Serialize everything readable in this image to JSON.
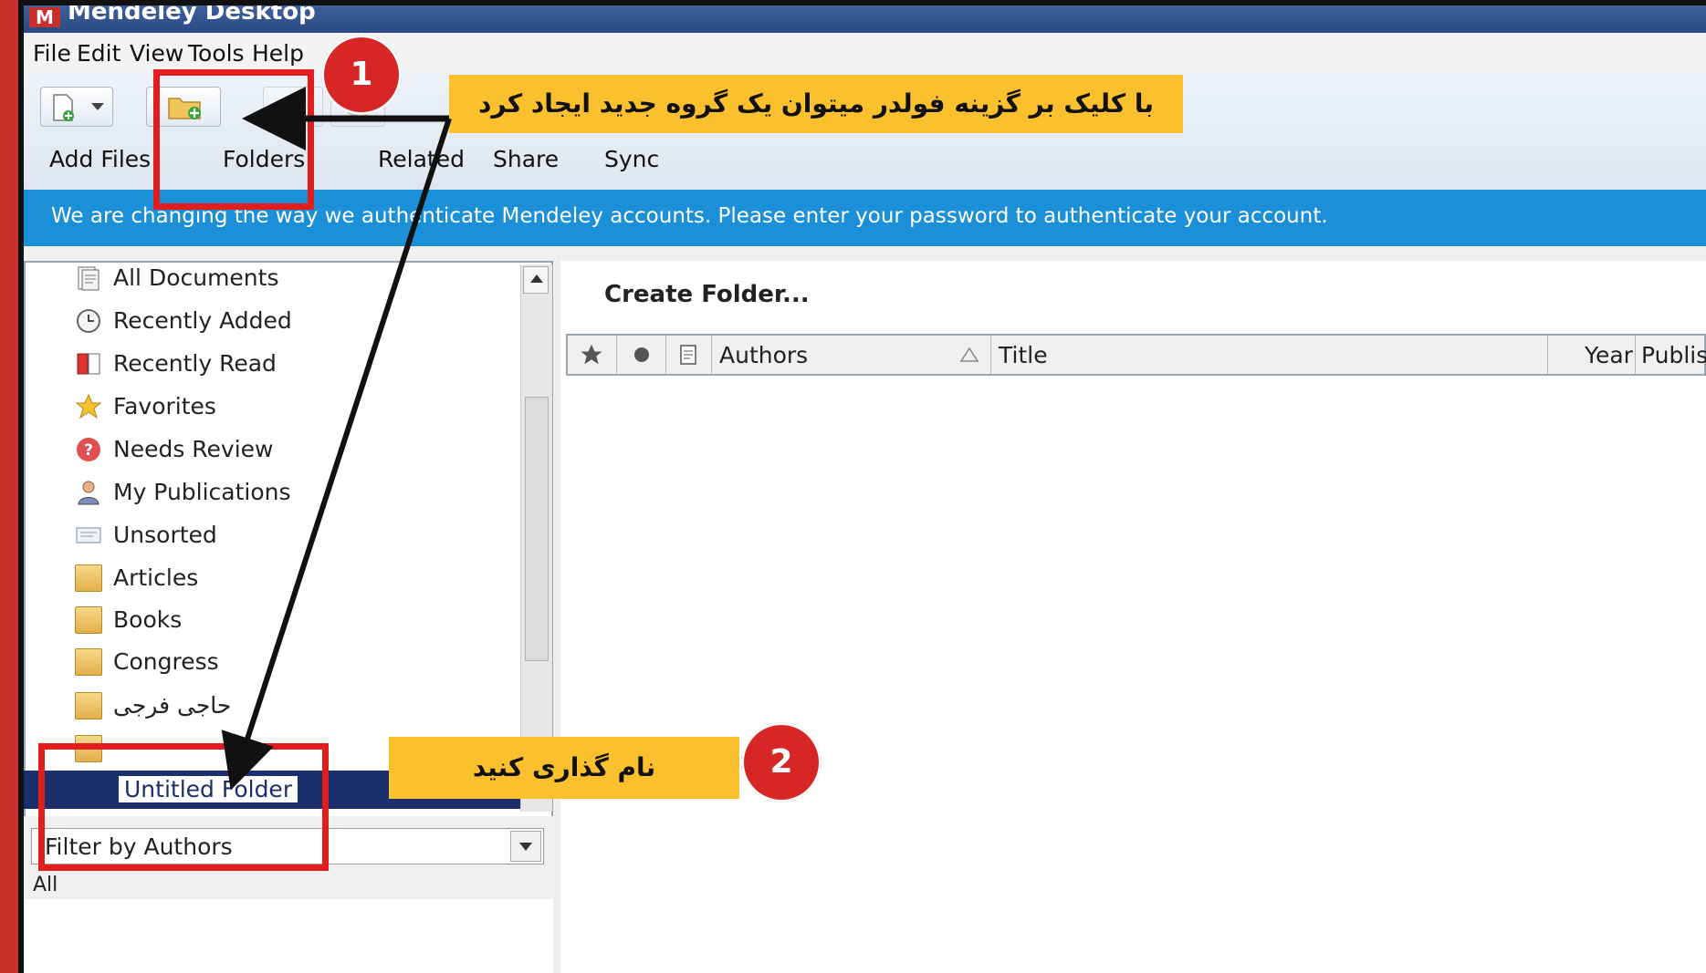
{
  "window": {
    "title": "Mendeley Desktop"
  },
  "menu": [
    "File",
    "Edit",
    "View",
    "Tools",
    "Help"
  ],
  "toolbar": {
    "add_files": "Add Files",
    "folders": "Folders",
    "related": "Related",
    "share": "Share",
    "sync": "Sync"
  },
  "notice": "We are changing the way we authenticate Mendeley accounts. Please enter your password to authenticate your account.",
  "sidebar": {
    "items": [
      {
        "label": "All Documents",
        "icon": "documents-icon"
      },
      {
        "label": "Recently Added",
        "icon": "clock-icon"
      },
      {
        "label": "Recently Read",
        "icon": "book-icon"
      },
      {
        "label": "Favorites",
        "icon": "star-icon"
      },
      {
        "label": "Needs Review",
        "icon": "question-icon"
      },
      {
        "label": "My Publications",
        "icon": "person-icon"
      },
      {
        "label": "Unsorted",
        "icon": "tray-icon"
      },
      {
        "label": "Articles",
        "icon": "folder-icon"
      },
      {
        "label": "Books",
        "icon": "folder-icon"
      },
      {
        "label": "Congress",
        "icon": "folder-icon"
      },
      {
        "label": "حاجی فرجی",
        "icon": "folder-icon"
      }
    ],
    "new_folder": "Untitled Folder"
  },
  "filter": {
    "label": "Filter by Authors",
    "value": "All"
  },
  "main": {
    "heading": "Create Folder...",
    "columns": {
      "authors": "Authors",
      "title": "Title",
      "year": "Year",
      "published": "Publis"
    }
  },
  "annotations": {
    "step1_number": "1",
    "step1_text": "با کلیک بر گزینه فولدر میتوان یک گروه جدید ایجاد کرد",
    "step2_number": "2",
    "step2_text": "نام گذاری کنید"
  },
  "colors": {
    "accent": "#1b8fd8",
    "selection": "#1b2f6d",
    "annotation_red": "#e21d1d",
    "callout_yellow": "#fbc02d"
  }
}
